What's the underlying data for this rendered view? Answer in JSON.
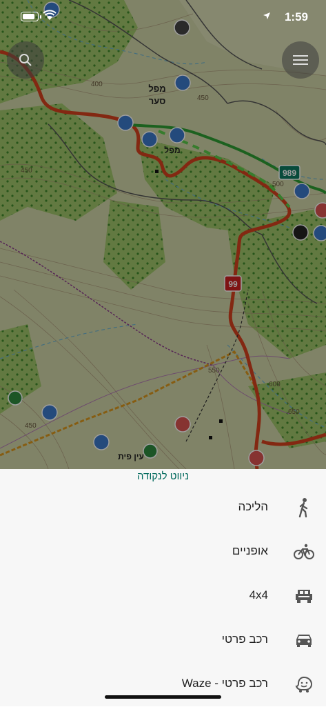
{
  "status_bar": {
    "time": "1:59"
  },
  "map": {
    "labels": {
      "place_1": "מפל",
      "place_2": "סער",
      "place_3": "מפל",
      "place_4": "עין פית",
      "contour_400": "400",
      "contour_450": "450",
      "contour_450b": "450",
      "contour_500": "500",
      "contour_550": "550",
      "contour_600": "600",
      "contour_650": "650",
      "contour_450c": "450",
      "road_99": "99",
      "road_989": "989"
    }
  },
  "sheet": {
    "title": "ניווט לנקודה",
    "options": [
      {
        "label": "הליכה",
        "icon": "walking-icon"
      },
      {
        "label": "אופניים",
        "icon": "bicycle-icon"
      },
      {
        "label": "4x4",
        "icon": "jeep-icon"
      },
      {
        "label": "רכב פרטי",
        "icon": "car-icon"
      },
      {
        "label": "רכב פרטי - Waze",
        "icon": "waze-icon"
      }
    ]
  },
  "colors": {
    "accent": "#00695c",
    "road_red": "#d4421e",
    "route_green": "#2e9d33"
  }
}
